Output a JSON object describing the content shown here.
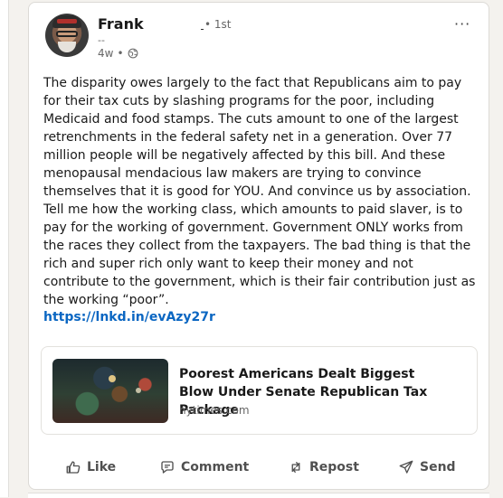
{
  "post": {
    "author": "Frank",
    "degree": "• 1st",
    "headline": "--",
    "time": "4w",
    "separator": "•",
    "text": "The disparity owes largely to the fact that Republicans aim to pay for their tax cuts by slashing programs for the poor, including Medicaid and food stamps. The cuts amount to one of the largest retrenchments in the federal safety net in a generation. Over 77 million people will be negatively affected by this bill. And these menopausal mendacious law makers are trying to convince themselves that it is good for YOU. And convince us by association. Tell me how the working class, which amounts to paid slaver, is to pay for the working of government. Government ONLY works from the races they collect from the taxpayers. The bad thing is that the rich and super rich only want to keep their money and not contribute to the government, which is their fair contribution just as the working “poor”.",
    "link": "https://lnkd.in/evAzy27r",
    "menu": "···"
  },
  "article": {
    "title": "Poorest Americans Dealt Biggest Blow Under Senate Republican Tax Package",
    "source": "nytimes.com"
  },
  "actions": {
    "like": "Like",
    "comment": "Comment",
    "repost": "Repost",
    "send": "Send"
  },
  "colors": {
    "link": "#0a66c2",
    "text": "#191919",
    "muted": "#666666",
    "action": "#505050"
  }
}
